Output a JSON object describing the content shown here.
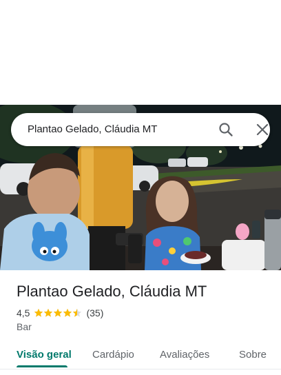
{
  "search": {
    "query": "Plantao Gelado, Cláudia MT"
  },
  "place": {
    "title": "Plantao Gelado, Cláudia MT",
    "rating": "4,5",
    "rating_value": 4.5,
    "review_count": "(35)",
    "category": "Bar"
  },
  "tabs": [
    {
      "label": "Visão geral",
      "active": true
    },
    {
      "label": "Cardápio",
      "active": false
    },
    {
      "label": "Avaliações",
      "active": false
    },
    {
      "label": "Sobre",
      "active": false
    }
  ],
  "colors": {
    "accent": "#00796b",
    "star": "#fbbc04",
    "text": "#202124",
    "secondary": "#5f6368"
  },
  "icons": {
    "search": "search-icon",
    "close": "close-icon",
    "star": "star-icon"
  }
}
